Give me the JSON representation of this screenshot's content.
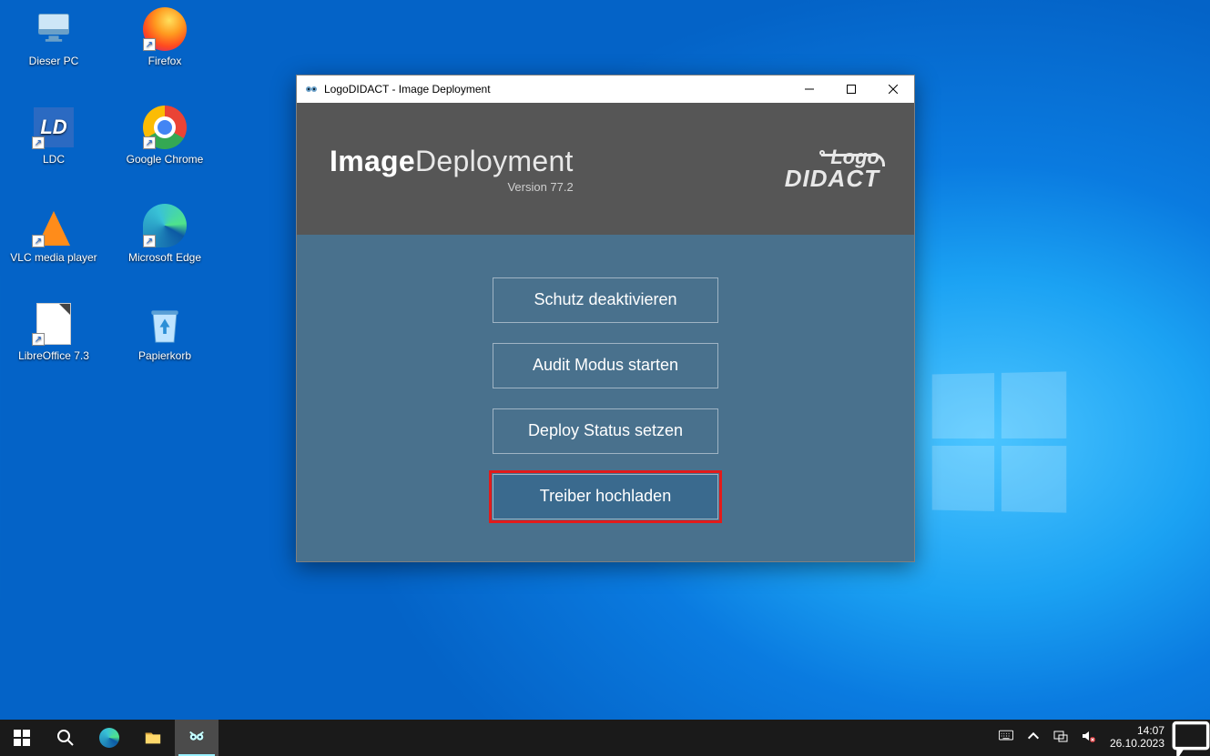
{
  "desktop_icons": {
    "pc": "Dieser PC",
    "firefox": "Firefox",
    "ldc": "LDC",
    "chrome": "Google Chrome",
    "vlc": "VLC media player",
    "edge": "Microsoft Edge",
    "libreoffice": "LibreOffice 7.3",
    "recyclebin": "Papierkorb"
  },
  "window": {
    "title": "LogoDIDACT - Image Deployment",
    "brand_left_bold": "Image",
    "brand_left_rest": "Deployment",
    "version": "Version 77.2",
    "brand_right_line1": "Logo",
    "brand_right_line2": "DIDACT",
    "buttons": {
      "b1": "Schutz deaktivieren",
      "b2": "Audit Modus starten",
      "b3": "Deploy Status setzen",
      "b4": "Treiber hochladen"
    }
  },
  "taskbar": {
    "time": "14:07",
    "date": "26.10.2023"
  }
}
